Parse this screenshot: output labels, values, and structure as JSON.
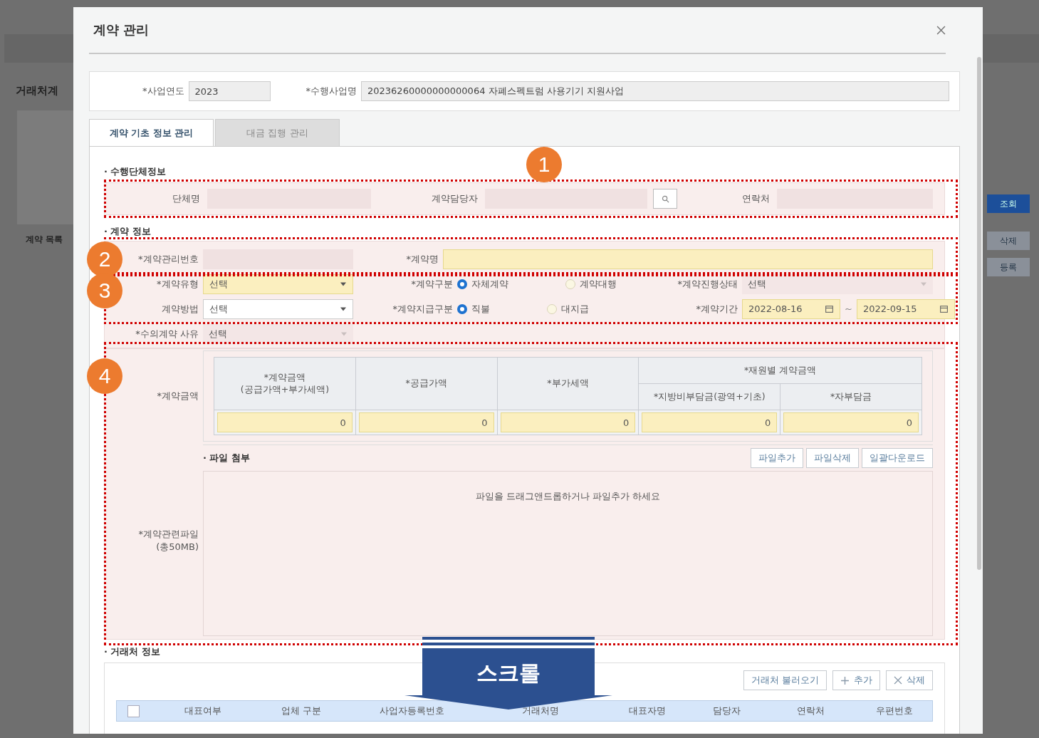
{
  "background": {
    "page_title": "거래처계",
    "section_title": "계약 목록",
    "buttons": [
      "조회",
      "삭제",
      "등록"
    ]
  },
  "window": {
    "title": "계약 관리"
  },
  "header": {
    "fields": [
      {
        "label": "*사업연도",
        "value": "2023"
      },
      {
        "label": "*수행사업명",
        "value": "20236260000000000064 자폐스펙트럼 사용기기 지원사업"
      }
    ]
  },
  "tabs": [
    {
      "label": "계약 기초 정보 관리",
      "selected": true
    },
    {
      "label": "대금 집행 관리",
      "selected": false
    }
  ],
  "org_section": {
    "title": "· 수행단체정보",
    "fields": [
      {
        "label": "단체명",
        "kind": "text"
      },
      {
        "label": "계약담당자",
        "kind": "search"
      },
      {
        "label": "연락처",
        "kind": "text"
      }
    ]
  },
  "contract_section": {
    "title": "· 계약 정보",
    "rows": [
      [
        {
          "kind": "readonly",
          "label": "*계약관리번호"
        },
        {
          "kind": "input",
          "label": "*계약명"
        }
      ],
      [
        {
          "kind": "select",
          "label": "*계약유형",
          "value": "선택",
          "required": true
        },
        {
          "kind": "radio",
          "label": "*계약구분",
          "options": [
            {
              "label": "자체계약",
              "selected": true
            },
            {
              "label": "계약대행",
              "selected": false
            }
          ]
        },
        {
          "kind": "plain-select",
          "label": "*계약진행상태",
          "value": "선택"
        }
      ],
      [
        {
          "kind": "select",
          "label": "계약방법",
          "value": "선택",
          "required": false
        },
        {
          "kind": "radio",
          "label": "*계약지급구분",
          "options": [
            {
              "label": "직불",
              "selected": true
            },
            {
              "label": "대지급",
              "selected": false
            }
          ]
        },
        {
          "kind": "daterange",
          "label": "*계약기간",
          "from": "2022-08-16",
          "separator": "~",
          "to": "2022-09-15"
        }
      ],
      [
        {
          "kind": "plain-select",
          "label": "*수의계약 사유",
          "value": "선택"
        }
      ]
    ]
  },
  "amount": {
    "label": "*계약금액",
    "columns": [
      {
        "lines": [
          "*계약금액",
          "(공급가액+부가세액)"
        ],
        "value": "0"
      },
      {
        "lines": [
          "*공급가액"
        ],
        "value": "0"
      },
      {
        "lines": [
          "*부가세액"
        ],
        "value": "0"
      },
      {
        "group": "*재원별 계약금액",
        "children": [
          {
            "lines": [
              "*지방비부담금(광역+기초)"
            ],
            "value": "0"
          },
          {
            "lines": [
              "*자부담금"
            ],
            "value": "0"
          }
        ]
      }
    ]
  },
  "files": {
    "label": [
      "*계약관련파일",
      "(총50MB)"
    ],
    "title": "· 파일 첨부",
    "buttons": [
      "파일추가",
      "파일삭제",
      "일괄다운로드"
    ],
    "drop_text": "파일을 드래그앤드롭하거나 파일추가 하세요"
  },
  "vendor_section": {
    "title": "· 거래처 정보",
    "buttons": [
      {
        "label": "거래처 불러오기",
        "kind": "load"
      },
      {
        "label": "추가",
        "kind": "add"
      },
      {
        "label": "삭제",
        "kind": "delete"
      }
    ],
    "select_all": {
      "checked": false
    },
    "columns": [
      "대표여부",
      "업체 구분",
      "사업자등록번호",
      "거래처명",
      "대표자명",
      "담당자",
      "연락처",
      "우편번호"
    ]
  },
  "annotations": {
    "markers": [
      "1",
      "2",
      "3",
      "4"
    ],
    "scroll_hint": "스크롤"
  }
}
